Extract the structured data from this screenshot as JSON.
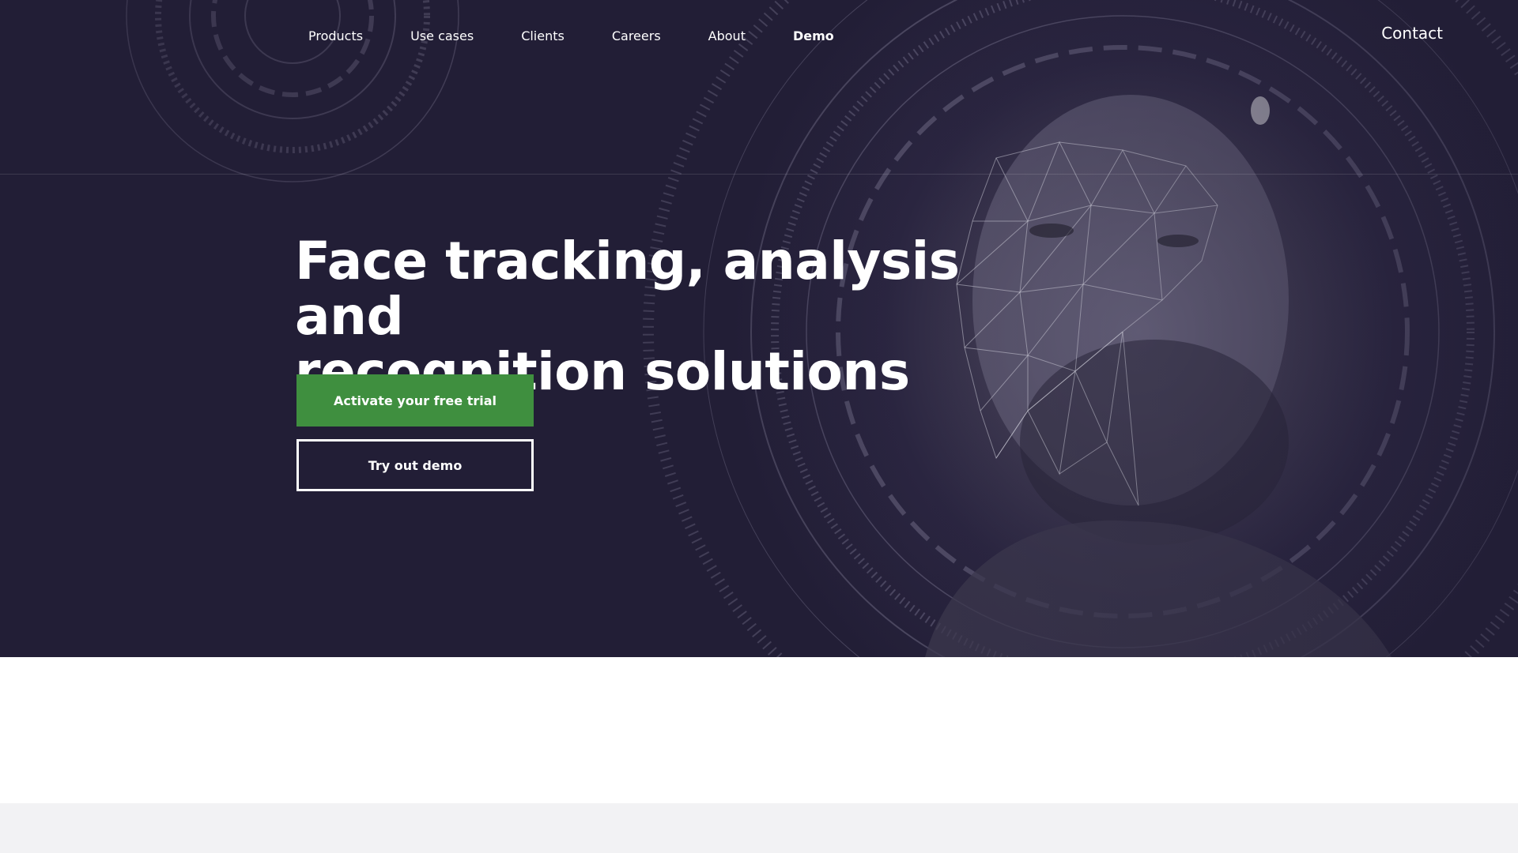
{
  "nav": {
    "items": [
      {
        "label": "Products"
      },
      {
        "label": "Use cases"
      },
      {
        "label": "Clients"
      },
      {
        "label": "Careers"
      },
      {
        "label": "About"
      },
      {
        "label": "Demo"
      }
    ],
    "contact_label": "Contact"
  },
  "hero": {
    "headline_line1": "Face tracking, analysis and",
    "headline_line2": "recognition solutions",
    "primary_button": "Activate your free trial",
    "secondary_button": "Try out demo"
  },
  "colors": {
    "hero_background": "#2a2540",
    "primary_button": "#3f8f3f",
    "page_background": "#ffffff",
    "footer_band": "#f2f2f4"
  },
  "icons": {
    "hero_image": "face-mesh-portrait"
  }
}
